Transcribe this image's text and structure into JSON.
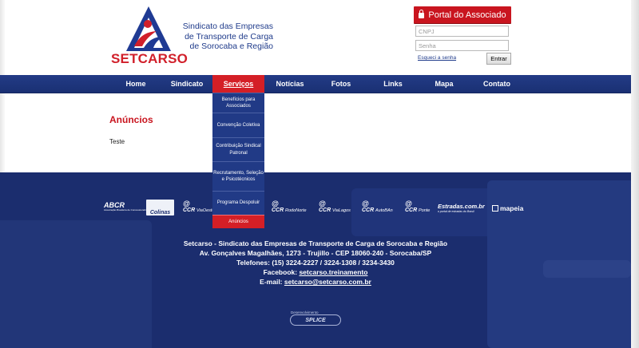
{
  "header": {
    "brand_name": "SETCARSO",
    "tagline": [
      "Sindicato das Empresas",
      "de Transporte de Carga",
      "de Sorocaba e Região"
    ]
  },
  "login": {
    "title": "Portal do Associado",
    "cnpj_placeholder": "CNPJ",
    "password_placeholder": "Senha",
    "forgot_label": "Esqueci a senha",
    "submit_label": "Entrar"
  },
  "nav": {
    "items": [
      {
        "label": "Home"
      },
      {
        "label": "Sindicato"
      },
      {
        "label": "Serviços",
        "active": true
      },
      {
        "label": "Notícias"
      },
      {
        "label": "Fotos"
      },
      {
        "label": "Links"
      },
      {
        "label": "Mapa"
      },
      {
        "label": "Contato"
      }
    ]
  },
  "dropdown": {
    "items": [
      {
        "label": "Benefícios para Associados"
      },
      {
        "label": "Convenção Coletiva"
      },
      {
        "label": "Contribuição Sindical Patronal"
      },
      {
        "label": "Recrutamento, Seleção e Psicotécnicos"
      },
      {
        "label": "Programa Despoluir"
      },
      {
        "label": "Anúncios",
        "active": true
      }
    ]
  },
  "content": {
    "title": "Anúncios",
    "body": "Teste"
  },
  "partners": {
    "abcr": "ABCR",
    "abcr_sub": "Associação Brasileira de Concessionárias de Rodovias",
    "colinas": "Colinas",
    "ccr": "CCR",
    "ccr_viaoeste": "ViaOeste",
    "ccr_rodonorte": "RodoNorte",
    "ccr_vialagos": "ViaLagos",
    "ccr_autoban": "AutoBAn",
    "ccr_ponte": "Ponte",
    "estradas": "Estradas.com.br",
    "estradas_sub": "o portal de estradas do Brasil",
    "mapeia": "mapeia"
  },
  "footer": {
    "org_line": "Setcarso - Sindicato das Empresas de Transporte de Carga de Sorocaba e Região",
    "address_line": "Av. Gonçalves Magalhães, 1273 - Trujillo - CEP 18060-240 - Sorocaba/SP",
    "phones_line": "Telefones: (15) 3224-2227 / 3224-1308 / 3234-3430",
    "facebook_label": "Facebook:",
    "facebook_link": "setcarso.treinamento",
    "email_label": "E-mail:",
    "email_link": "setcarso@setcarso.com.br",
    "dev_label": "Desenvolvimento",
    "dev_brand": "SPLICE"
  },
  "colors": {
    "brand_red": "#d11f2a",
    "nav_blue": "#1f3780",
    "footer_blue": "#1b2d6e"
  }
}
